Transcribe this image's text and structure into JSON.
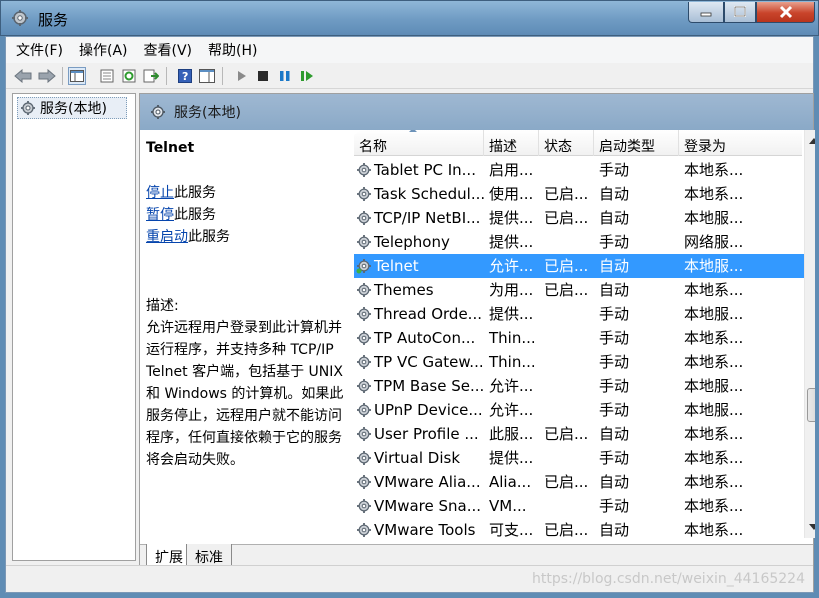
{
  "window": {
    "title": "服务",
    "icon": "services-gear-icon"
  },
  "menu": [
    {
      "label": "文件(F)"
    },
    {
      "label": "操作(A)"
    },
    {
      "label": "查看(V)"
    },
    {
      "label": "帮助(H)"
    }
  ],
  "toolbar": {
    "icons": [
      "back-icon",
      "forward-icon",
      "show-console-tree-icon",
      "properties-icon",
      "refresh-icon",
      "export-list-icon",
      "help-icon",
      "show-action-pane-icon",
      "start-service-icon",
      "stop-service-icon",
      "pause-service-icon",
      "restart-service-icon"
    ]
  },
  "tree": {
    "root_label": "服务(本地)"
  },
  "pane": {
    "header": "服务(本地)"
  },
  "detail": {
    "service_name": "Telnet",
    "stop_link": "停止",
    "stop_suffix": "此服务",
    "pause_link": "暂停",
    "pause_suffix": "此服务",
    "restart_link": "重启动",
    "restart_suffix": "此服务",
    "description_label": "描述:",
    "description": "允许远程用户登录到此计算机并运行程序，并支持多种 TCP/IP Telnet 客户端，包括基于 UNIX 和 Windows 的计算机。如果此服务停止，远程用户就不能访问程序，任何直接依赖于它的服务将会启动失败。"
  },
  "table": {
    "columns": [
      "名称",
      "描述",
      "状态",
      "启动类型",
      "登录为"
    ],
    "rows": [
      {
        "name": "Tablet PC In...",
        "desc": "启用...",
        "status": "",
        "start": "手动",
        "logon": "本地系..."
      },
      {
        "name": "Task Schedul...",
        "desc": "使用...",
        "status": "已启...",
        "start": "自动",
        "logon": "本地系..."
      },
      {
        "name": "TCP/IP NetBI...",
        "desc": "提供...",
        "status": "已启...",
        "start": "自动",
        "logon": "本地服..."
      },
      {
        "name": "Telephony",
        "desc": "提供...",
        "status": "",
        "start": "手动",
        "logon": "网络服..."
      },
      {
        "name": "Telnet",
        "desc": "允许...",
        "status": "已启...",
        "start": "自动",
        "logon": "本地服...",
        "selected": true
      },
      {
        "name": "Themes",
        "desc": "为用...",
        "status": "已启...",
        "start": "自动",
        "logon": "本地系..."
      },
      {
        "name": "Thread Orde...",
        "desc": "提供...",
        "status": "",
        "start": "手动",
        "logon": "本地服..."
      },
      {
        "name": "TP AutoCon...",
        "desc": "Thin...",
        "status": "",
        "start": "手动",
        "logon": "本地系..."
      },
      {
        "name": "TP VC Gatew...",
        "desc": "Thin...",
        "status": "",
        "start": "手动",
        "logon": "本地系..."
      },
      {
        "name": "TPM Base Se...",
        "desc": "允许...",
        "status": "",
        "start": "手动",
        "logon": "本地服..."
      },
      {
        "name": "UPnP Device...",
        "desc": "允许...",
        "status": "",
        "start": "手动",
        "logon": "本地服..."
      },
      {
        "name": "User Profile ...",
        "desc": "此服...",
        "status": "已启...",
        "start": "自动",
        "logon": "本地系..."
      },
      {
        "name": "Virtual Disk",
        "desc": "提供...",
        "status": "",
        "start": "手动",
        "logon": "本地系..."
      },
      {
        "name": "VMware Alia...",
        "desc": "Alia...",
        "status": "已启...",
        "start": "自动",
        "logon": "本地系..."
      },
      {
        "name": "VMware Sna...",
        "desc": "VM...",
        "status": "",
        "start": "手动",
        "logon": "本地系..."
      },
      {
        "name": "VMware Tools",
        "desc": "可支...",
        "status": "已启...",
        "start": "自动",
        "logon": "本地系..."
      }
    ]
  },
  "tabs": [
    {
      "label": "扩展",
      "active": true
    },
    {
      "label": "标准",
      "active": false
    }
  ],
  "statusbar": {
    "watermark": "https://blog.csdn.net/weixin_44165224"
  }
}
